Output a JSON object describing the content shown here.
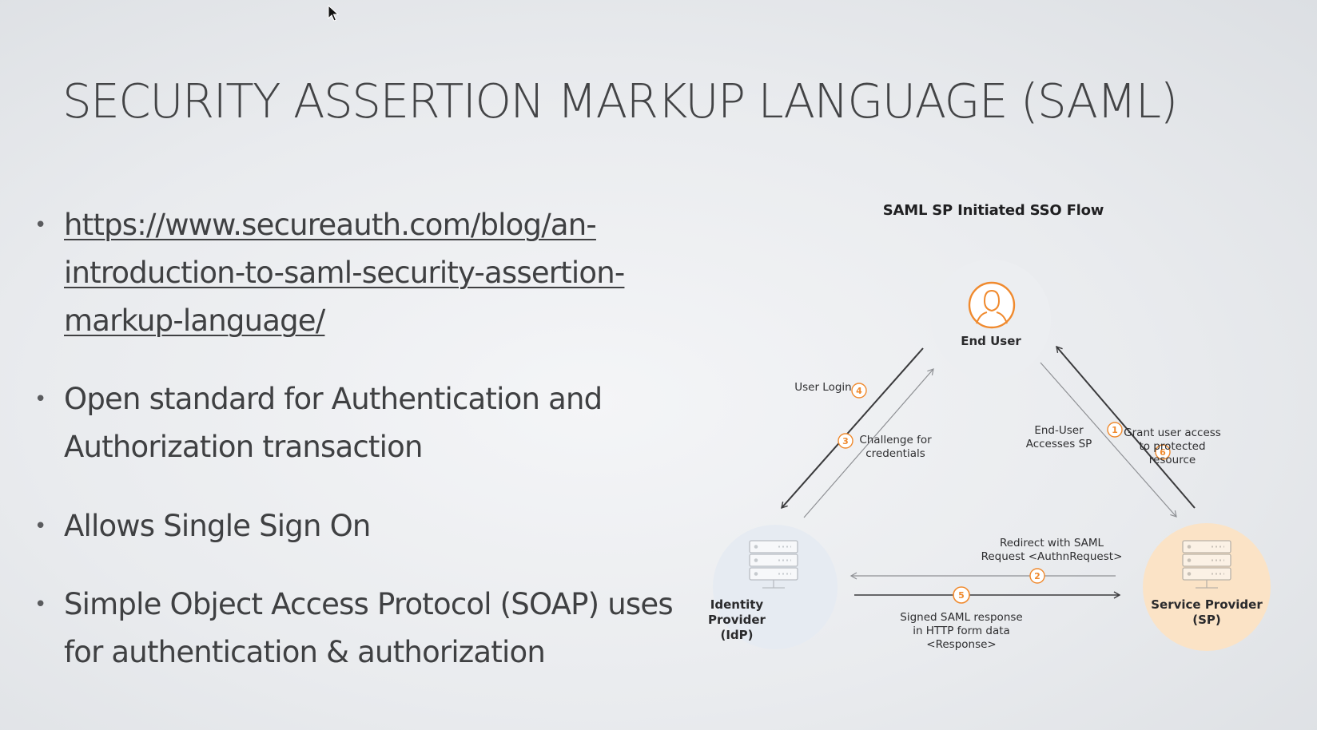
{
  "slide": {
    "title": "SECURITY ASSERTION MARKUP LANGUAGE (SAML)"
  },
  "bullets": [
    {
      "text": "https://www.secureauth.com/blog/an-introduction-to-saml-security-assertion-markup-language/",
      "is_link": true
    },
    {
      "text": "Open standard for Authentication and Authorization transaction"
    },
    {
      "text": "Allows Single Sign On"
    },
    {
      "text": "Simple Object Access Protocol (SOAP) uses for authentication & authorization"
    }
  ],
  "diagram": {
    "title": "SAML SP Initiated SSO Flow",
    "nodes": {
      "end_user": "End User",
      "idp": "Identity Provider\n(IdP)",
      "sp": "Service Provider\n(SP)"
    },
    "steps": [
      {
        "num": "1",
        "label": "End-User\nAccesses SP"
      },
      {
        "num": "2",
        "label": "Redirect with SAML\nRequest <AuthnRequest>"
      },
      {
        "num": "3",
        "label": "Challenge for\ncredentials"
      },
      {
        "num": "4",
        "label": "User Login"
      },
      {
        "num": "5",
        "label": "Signed SAML response\nin HTTP form data\n<Response>"
      },
      {
        "num": "6",
        "label": "Grant user access\nto protected\nresource"
      }
    ],
    "colors": {
      "accent": "#f08a2e",
      "sp_bg": "#fbe3c6",
      "idp_bg": "#e6ebf2",
      "user_bg": "#eceef1",
      "arrow_dark": "#3a3a3c",
      "arrow_light": "#8e9094"
    },
    "icons": {
      "end_user": "user-icon",
      "idp": "server-icon",
      "sp": "server-icon"
    }
  }
}
